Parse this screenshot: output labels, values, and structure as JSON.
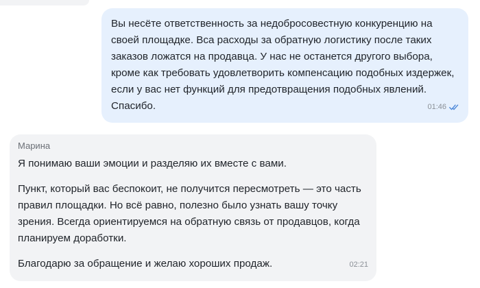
{
  "outgoing": {
    "text": "Вы несёте ответственность за недобросовестную конкуренцию на своей площадке. Вса расходы за обратную логистику после таких заказов ложатся на продавца. У нас не останется другого выбора, кроме как требовать удовлетворить компенсацию подобных издержек, если у вас нет функций для предотвращения подобных явлений. Спасибо.",
    "time": "01:46",
    "status_icon": "double-check-icon",
    "accent_color": "#4a86d8"
  },
  "incoming": {
    "sender": "Марина",
    "paragraphs": [
      "Я понимаю ваши эмоции и разделяю их вместе с вами.",
      "Пункт, который вас беспокоит, не получится пересмотреть — это часть правил площадки. Но всё равно, полезно было узнать вашу точку зрения. Всегда ориентируемся на обратную связь от продавцов, когда планируем доработки.",
      "Благодарю за обращение и желаю хороших продаж."
    ],
    "time": "02:21"
  }
}
